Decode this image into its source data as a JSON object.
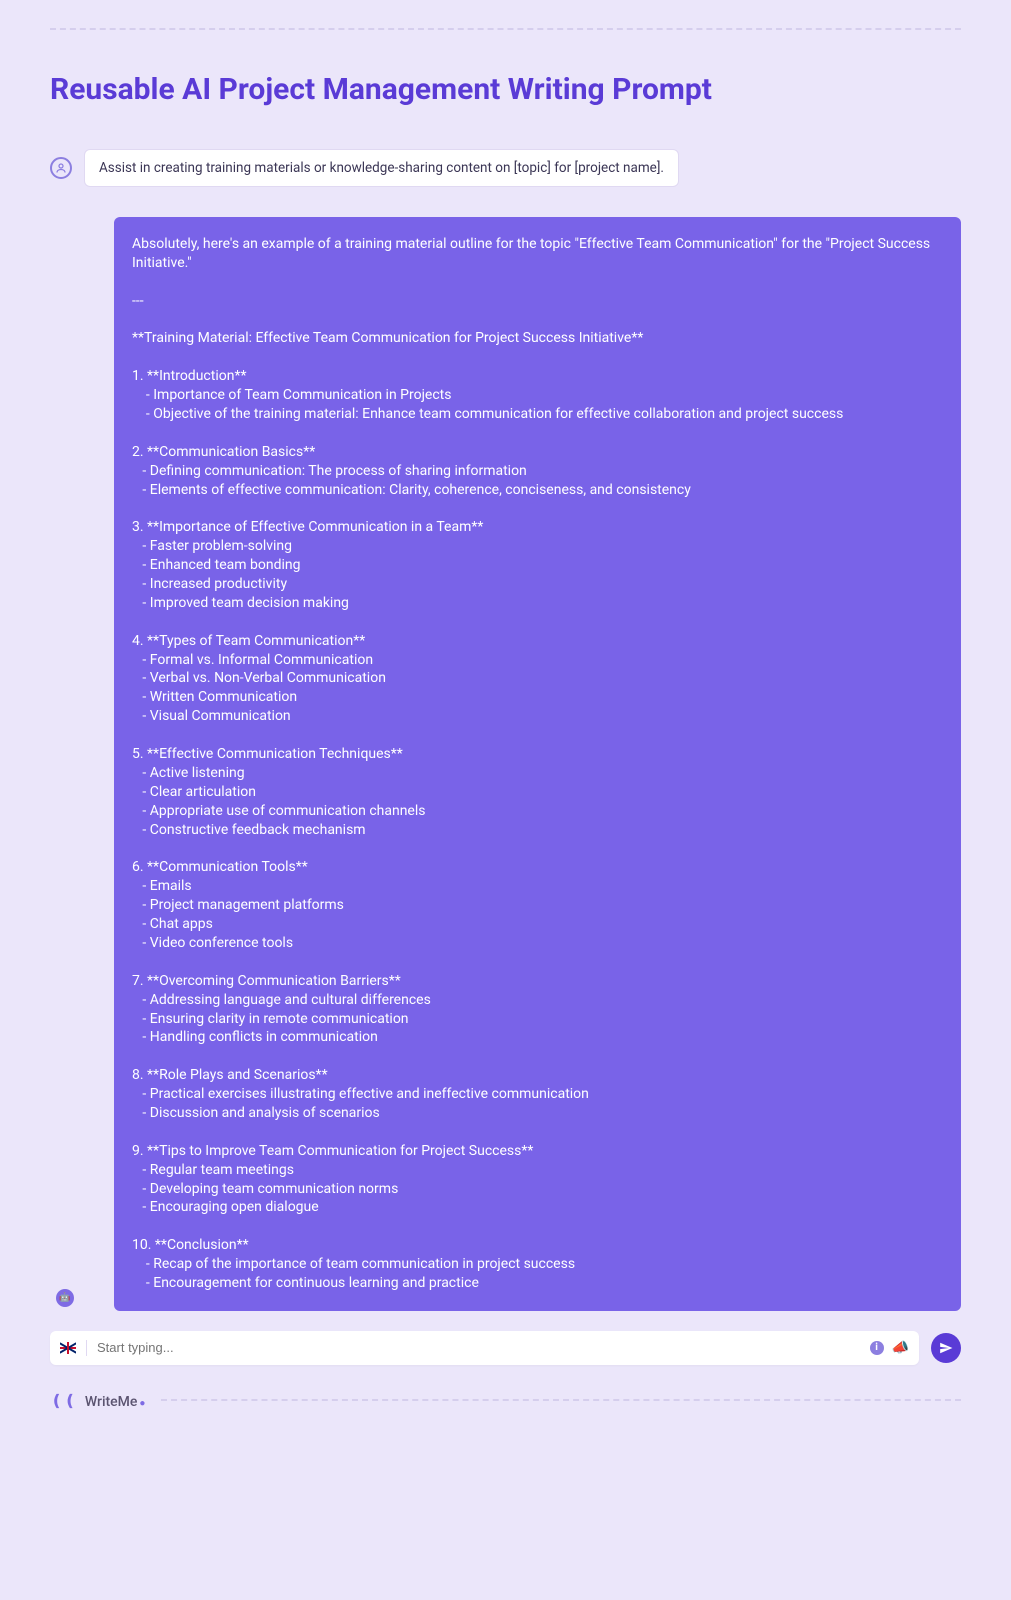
{
  "page": {
    "title": "Reusable AI Project Management Writing Prompt"
  },
  "user": {
    "prompt": "Assist in creating training materials or knowledge-sharing content on [topic] for [project name]."
  },
  "ai": {
    "response": "Absolutely, here's an example of a training material outline for the topic \"Effective Team Communication\" for the \"Project Success Initiative.\"\n\n---\n\n**Training Material: Effective Team Communication for Project Success Initiative**\n\n1. **Introduction**\n    - Importance of Team Communication in Projects\n    - Objective of the training material: Enhance team communication for effective collaboration and project success\n\n2. **Communication Basics**\n   - Defining communication: The process of sharing information\n   - Elements of effective communication: Clarity, coherence, conciseness, and consistency\n\n3. **Importance of Effective Communication in a Team**\n   - Faster problem-solving\n   - Enhanced team bonding\n   - Increased productivity\n   - Improved team decision making\n\n4. **Types of Team Communication**\n   - Formal vs. Informal Communication\n   - Verbal vs. Non-Verbal Communication\n   - Written Communication\n   - Visual Communication\n\n5. **Effective Communication Techniques**\n   - Active listening\n   - Clear articulation\n   - Appropriate use of communication channels\n   - Constructive feedback mechanism\n\n6. **Communication Tools**\n   - Emails\n   - Project management platforms\n   - Chat apps\n   - Video conference tools\n\n7. **Overcoming Communication Barriers**\n   - Addressing language and cultural differences\n   - Ensuring clarity in remote communication\n   - Handling conflicts in communication\n\n8. **Role Plays and Scenarios**\n   - Practical exercises illustrating effective and ineffective communication\n   - Discussion and analysis of scenarios\n\n9. **Tips to Improve Team Communication for Project Success**\n   - Regular team meetings\n   - Developing team communication norms\n   - Encouraging open dialogue\n\n10. **Conclusion**\n    - Recap of the importance of team communication in project success\n    - Encouragement for continuous learning and practice"
  },
  "input": {
    "placeholder": "Start typing..."
  },
  "footer": {
    "brand": "WriteMe"
  }
}
